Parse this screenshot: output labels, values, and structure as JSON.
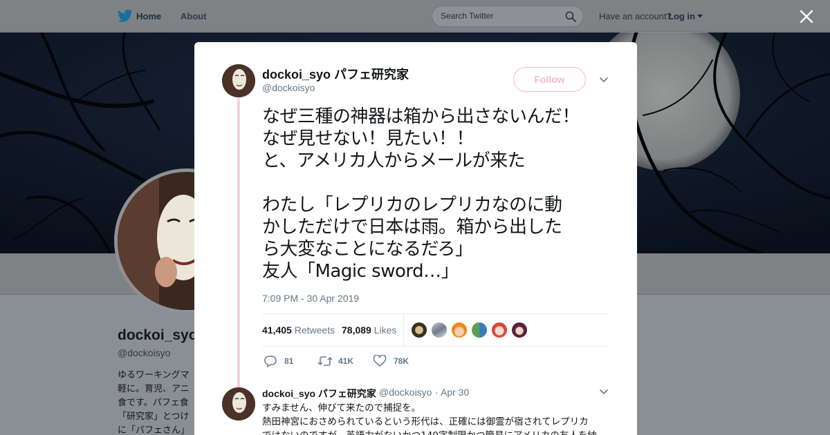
{
  "colors": {
    "accent": "#f5b8cf",
    "thread": "#f7d0e0",
    "muted": "#657786",
    "text": "#14171a",
    "twitter_blue": "#1da1f2"
  },
  "topbar": {
    "home_label": "Home",
    "about_label": "About",
    "search_placeholder": "Search Twitter",
    "account_text": "Have an account?",
    "login_label": "Log in"
  },
  "profile": {
    "name": "dockoi_syo",
    "handle": "@dockoisyo",
    "bio": "ゆるワーキングマ\n軽に。育児、アニ\n食です。パフェ食\n「研究家」とつけ\nに「パフェさん」"
  },
  "tweet": {
    "author_name": "dockoi_syo パフェ研究家",
    "author_handle": "@dockoisyo",
    "follow_label": "Follow",
    "text": "なぜ三種の神器は箱から出さないんだ！\nなぜ見せない！見たい！！\nと、アメリカ人からメールが来た\n\nわたし「レプリカのレプリカなのに動\nかしただけで日本は雨。箱から出した\nら大変なことになるだろ」\n友人「Magic sword…」",
    "timestamp": "7:09 PM - 30 Apr 2019",
    "retweets_count": "41,405",
    "retweets_label": "Retweets",
    "likes_count": "78,089",
    "likes_label": "Likes",
    "reply_count": "81",
    "retweet_action_count": "41K",
    "like_action_count": "78K"
  },
  "reply": {
    "author_name": "dockoi_syo パフェ研究家",
    "author_handle": "@dockoisyo",
    "separator": "·",
    "date": "Apr 30",
    "text": "すみません、伸びて来たので捕捉を。\n熱田神宮におさめられているという形代は、正確には御霊が宿されてレプリカ\nではないのですが、英語力がないかつ140字制限かつ簡易にアメリカの友人を納"
  },
  "icons": {
    "logo": "twitter-bird-icon",
    "search": "search-icon",
    "close": "close-icon",
    "caret": "chevron-down-icon",
    "reply": "reply-icon",
    "retweet": "retweet-icon",
    "like": "heart-icon"
  }
}
